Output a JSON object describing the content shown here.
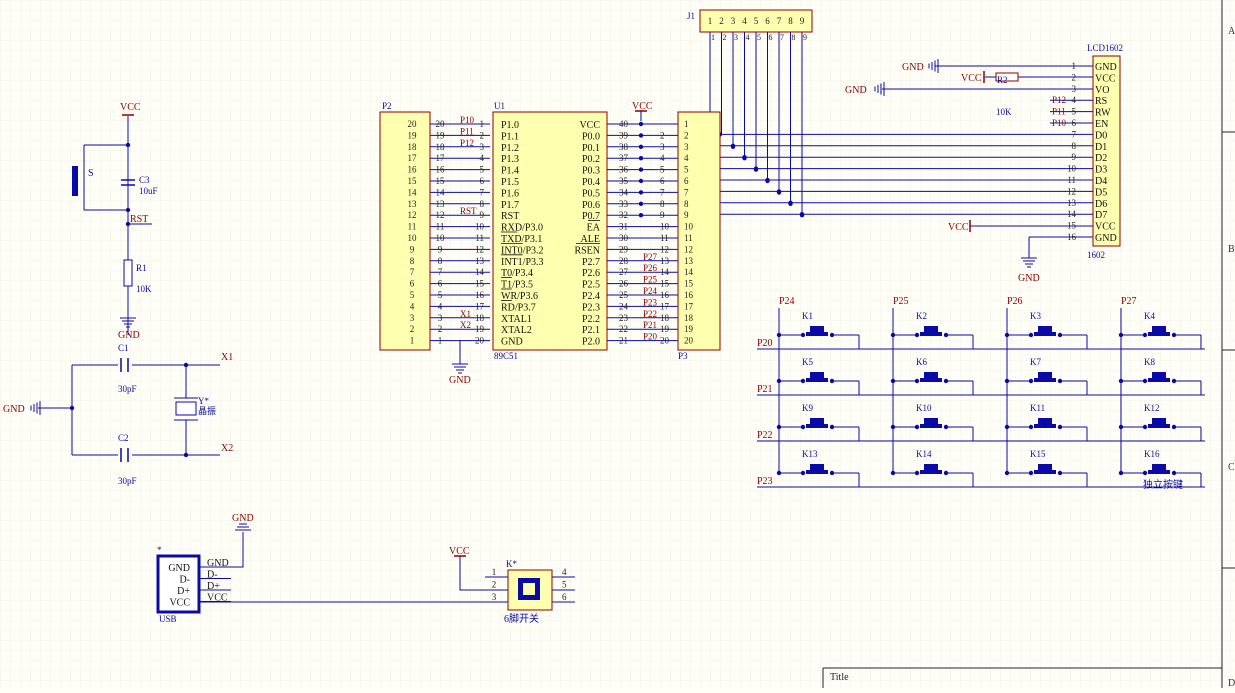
{
  "sheet": {
    "title_label": "Title",
    "zone_letters": [
      "A",
      "B",
      "C",
      "D"
    ]
  },
  "colors": {
    "wire": "#0a0aa6",
    "part_fill": "#ffffb0",
    "part_stroke": "#8b0000",
    "net_label": "#8b0000",
    "designator": "#0a0aa6",
    "key_fill": "#0a0aa6",
    "grid": "#e4e4dc",
    "background": "#fffff8"
  },
  "power": {
    "vcc": "VCC",
    "gnd": "GND"
  },
  "p2": {
    "designator": "P2",
    "pins": [
      "20",
      "19",
      "18",
      "17",
      "16",
      "15",
      "14",
      "13",
      "12",
      "11",
      "10",
      "9",
      "8",
      "7",
      "6",
      "5",
      "4",
      "3",
      "2",
      "1"
    ]
  },
  "u1": {
    "designator": "U1",
    "part": "89C51",
    "left_names": [
      "P1.0",
      "P1.1",
      "P1.2",
      "P1.3",
      "P1.4",
      "P1.5",
      "P1.6",
      "P1.7",
      "RST",
      "RXD/P3.0",
      "TXD/P3.1",
      "INT0/P3.2",
      "INT1/P3.3",
      "T0/P3.4",
      "T1/P3.5",
      "WR/P3.6",
      "RD/P3.7",
      "XTAL1",
      "XTAL2",
      "GND"
    ],
    "left_nums": [
      "1",
      "2",
      "3",
      "4",
      "5",
      "6",
      "7",
      "8",
      "9",
      "10",
      "11",
      "12",
      "13",
      "14",
      "15",
      "16",
      "17",
      "18",
      "19",
      "20"
    ],
    "left_outer": [
      "20",
      "19",
      "18",
      "17",
      "16",
      "15",
      "14",
      "13",
      "12",
      "11",
      "10",
      "9",
      "8",
      "7",
      "6",
      "5",
      "4",
      "3",
      "2",
      "1"
    ],
    "left_nets": [
      "P10",
      "P11",
      "P12",
      "",
      "",
      "",
      "",
      "",
      "RST",
      "",
      "",
      "",
      "",
      "",
      "",
      "",
      "",
      "X1",
      "X2",
      ""
    ],
    "right_names": [
      "VCC",
      "P0.0",
      "P0.1",
      "P0.2",
      "P0.3",
      "P0.4",
      "P0.5",
      "P0.6",
      "P0.7",
      "EA",
      "ALE",
      "RSEN",
      "P2.7",
      "P2.6",
      "P2.5",
      "P2.4",
      "P2.3",
      "P2.2",
      "P2.1",
      "P2.0"
    ],
    "right_nums": [
      "40",
      "39",
      "38",
      "37",
      "36",
      "35",
      "34",
      "33",
      "32",
      "31",
      "30",
      "29",
      "28",
      "27",
      "26",
      "25",
      "24",
      "23",
      "22",
      "21"
    ],
    "right_nets": [
      "",
      "",
      "",
      "",
      "",
      "",
      "",
      "",
      "",
      "",
      "",
      "",
      "P27",
      "P26",
      "P25",
      "P24",
      "P23",
      "P22",
      "P21",
      "P20"
    ]
  },
  "p3": {
    "designator": "P3",
    "pins": [
      "1",
      "2",
      "3",
      "4",
      "5",
      "6",
      "7",
      "8",
      "9",
      "10",
      "11",
      "12",
      "13",
      "14",
      "15",
      "16",
      "17",
      "18",
      "19",
      "20"
    ]
  },
  "j1": {
    "designator": "J1",
    "pins": [
      "1",
      "2",
      "3",
      "4",
      "5",
      "6",
      "7",
      "8",
      "9"
    ]
  },
  "lcd": {
    "designator": "LCD1602",
    "part": "1602",
    "pin_nums": [
      "1",
      "2",
      "3",
      "4",
      "5",
      "6",
      "7",
      "8",
      "9",
      "10",
      "11",
      "12",
      "13",
      "14",
      "15",
      "16"
    ],
    "pin_names": [
      "GND",
      "VCC",
      "VO",
      "RS",
      "RW",
      "EN",
      "D0",
      "D1",
      "D2",
      "D3",
      "D4",
      "D5",
      "D6",
      "D7",
      "VCC",
      "GND"
    ],
    "nets": [
      "",
      "",
      "",
      "P12",
      "P11",
      "P10",
      "",
      "",
      "",
      "",
      "",
      "",
      "",
      "",
      "",
      ""
    ]
  },
  "r2": {
    "designator": "R2",
    "value": "10K"
  },
  "reset": {
    "switch": "S",
    "cap": "C3",
    "cap_value": "10uF",
    "net": "RST",
    "res": "R1",
    "res_value": "10K"
  },
  "crystal": {
    "c1": "C1",
    "c1_value": "30pF",
    "c2": "C2",
    "c2_value": "30pF",
    "x1": "X1",
    "x2": "X2",
    "designator": "Y*",
    "label": "晶振"
  },
  "keypad": {
    "columns": [
      "P24",
      "P25",
      "P26",
      "P27"
    ],
    "rows": [
      "P20",
      "P21",
      "P22",
      "P23"
    ],
    "keys": [
      "K1",
      "K2",
      "K3",
      "K4",
      "K5",
      "K6",
      "K7",
      "K8",
      "K9",
      "K10",
      "K11",
      "K12",
      "K13",
      "K14",
      "K15",
      "K16"
    ],
    "label": "独立按键"
  },
  "usb": {
    "designator": "USB",
    "dot": "*",
    "pins": [
      "GND",
      "D-",
      "D+",
      "VCC"
    ]
  },
  "switch6": {
    "designator": "K*",
    "label": "6脚开关",
    "left_pins": [
      "1",
      "2",
      "3"
    ],
    "right_pins": [
      "4",
      "5",
      "6"
    ]
  }
}
